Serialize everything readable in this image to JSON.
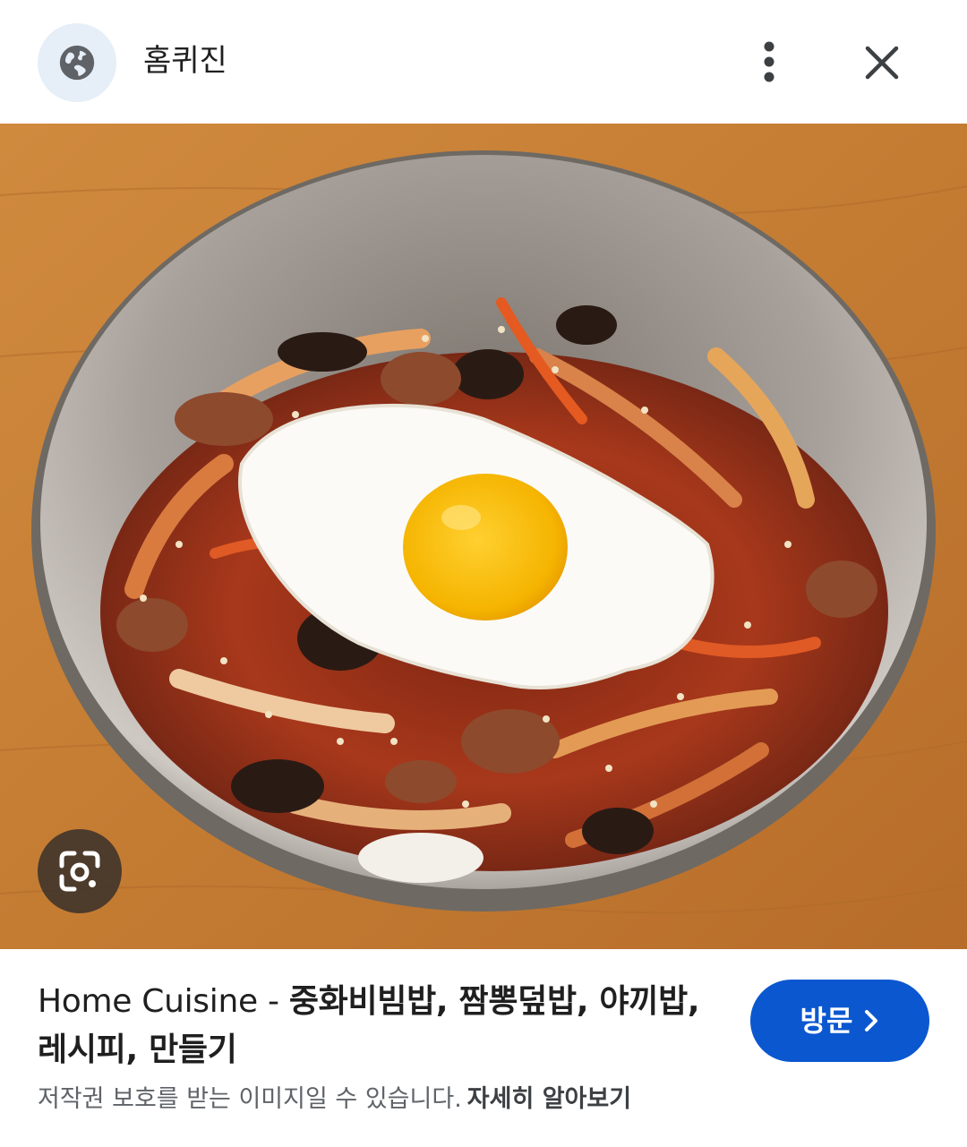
{
  "header": {
    "site_name": "홈퀴진",
    "favicon_icon": "globe-icon",
    "more_icon": "more-vert-icon",
    "close_icon": "close-icon"
  },
  "image": {
    "lens_icon": "google-lens-icon"
  },
  "result": {
    "source_name": "Home Cuisine",
    "separator": " - ",
    "headline": "중화비빔밥, 짬뽕덮밥, 야끼밥, 레시피, 만들기",
    "visit_label": "방문",
    "visit_icon": "chevron-right-icon"
  },
  "notice": {
    "copyright_text": "저작권 보호를 받는 이미지일 수 있습니다.",
    "learn_more": "자세히 알아보기"
  },
  "colors": {
    "accent": "#0b57d0",
    "favicon_bg": "#e6eef8",
    "text_primary": "#1f1f1f",
    "text_secondary": "#5f6368"
  }
}
